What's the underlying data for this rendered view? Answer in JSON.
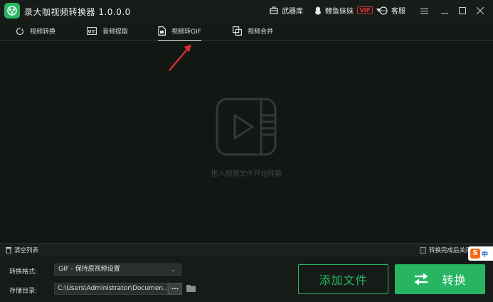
{
  "window": {
    "title": "录大咖视频转换器 1.0.0.0",
    "armory_label": "武器库",
    "user_name": "鲤鱼妹妹",
    "vip_badge": "VIP",
    "service_label": "客服"
  },
  "tabs": [
    {
      "label": "视频转换",
      "active": false
    },
    {
      "label": "音频提取",
      "active": false
    },
    {
      "label": "视频转GIF",
      "active": true
    },
    {
      "label": "视频合并",
      "active": false
    }
  ],
  "main": {
    "drop_hint": "拖入视频文件开始转换"
  },
  "listbar": {
    "clear_label": "清空列表",
    "auto_close_label": "转换完成后关闭",
    "auto_close_checked": false
  },
  "settings": {
    "format_label": "转换格式:",
    "format_value": "GIF - 保持原视频设置",
    "output_label": "存储目录:",
    "output_path": "C:\\Users\\Administrator\\Documen...",
    "browse_label": "..."
  },
  "actions": {
    "add_files_label": "添加文件",
    "convert_label": "转换"
  },
  "ime": {
    "logo_letter": "S",
    "mode_label": "中"
  },
  "colors": {
    "accent": "#27b562",
    "background": "#121714",
    "vip": "#e0302d",
    "annotation_arrow": "#e0302d"
  }
}
